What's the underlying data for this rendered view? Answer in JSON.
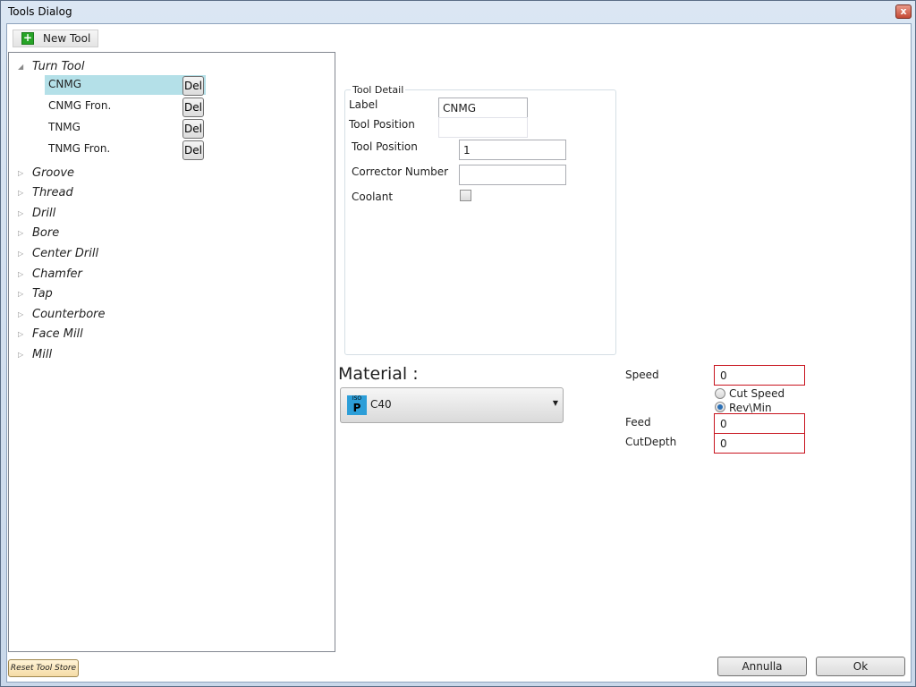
{
  "window": {
    "title": "Tools Dialog",
    "close_label": "x"
  },
  "toolbar": {
    "new_tool_label": "New Tool"
  },
  "tree": {
    "expanded_arrow": "◢",
    "collapsed_arrow": "▷",
    "root": {
      "label": "Turn Tool"
    },
    "children": [
      {
        "label": "CNMG",
        "del_label": "Del"
      },
      {
        "label": "CNMG Fron.",
        "del_label": "Del"
      },
      {
        "label": "TNMG",
        "del_label": "Del"
      },
      {
        "label": "TNMG Fron.",
        "del_label": "Del"
      }
    ],
    "categories": [
      "Groove",
      "Thread",
      "Drill",
      "Bore",
      "Center Drill",
      "Chamfer",
      "Tap",
      "Counterbore",
      "Face Mill",
      "Mill"
    ]
  },
  "reset_label": "Reset Tool Store",
  "tool_detail": {
    "group_title": "Tool Detail",
    "label_caption": "Label",
    "label_value": "CNMG",
    "tool_position_caption_1": "Tool Position",
    "tool_position_value_1": "",
    "tool_position_caption_2": "Tool Position",
    "tool_position_value_2": "1",
    "corrector_caption": "Corrector Number",
    "corrector_value": "",
    "coolant_caption": "Coolant",
    "coolant_checked": false
  },
  "material": {
    "title": "Material :",
    "iso_small": "ISO",
    "iso_letter": "P",
    "selected": "C40",
    "arrow": "▼"
  },
  "cutting": {
    "speed_label": "Speed",
    "speed_value": "0",
    "cut_speed_label": "Cut Speed",
    "rev_min_label": "Rev\\Min",
    "selected_mode": "Rev\\Min",
    "feed_label": "Feed",
    "feed_value": "0",
    "cutdepth_label": "CutDepth",
    "cutdepth_value": "0"
  },
  "buttons": {
    "cancel_label": "Annulla",
    "ok_label": "Ok"
  }
}
